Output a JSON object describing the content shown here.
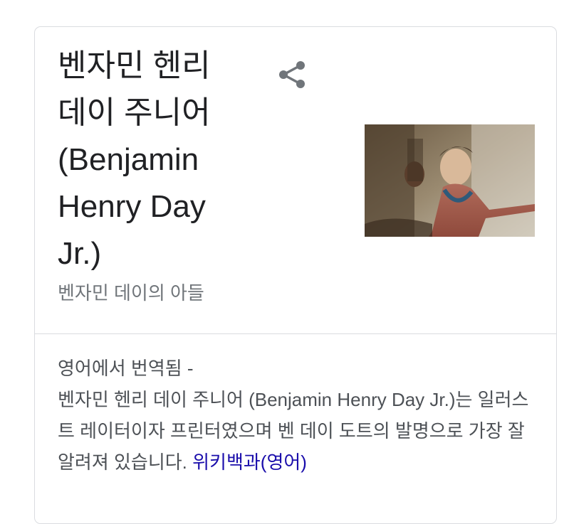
{
  "panel": {
    "title_lines": [
      "벤자민 헨리",
      "데이 주니어",
      "(Benjamin",
      "Henry Day",
      "Jr.)"
    ],
    "subtitle": "벤자민 데이의 아들",
    "share_icon": "share-icon",
    "image_alt": "portrait-painting-thumbnail"
  },
  "description": {
    "translated_label": "영어에서 번역됨 -",
    "body": "벤자민 헨리 데이 주니어 (Benjamin Henry Day Jr.)는 일러스트 레이터이자 프린터였으며 벤 데이 도트의 발명으로 가장 잘 알려져 있습니다.",
    "source_link": "위키백과(영어)"
  }
}
